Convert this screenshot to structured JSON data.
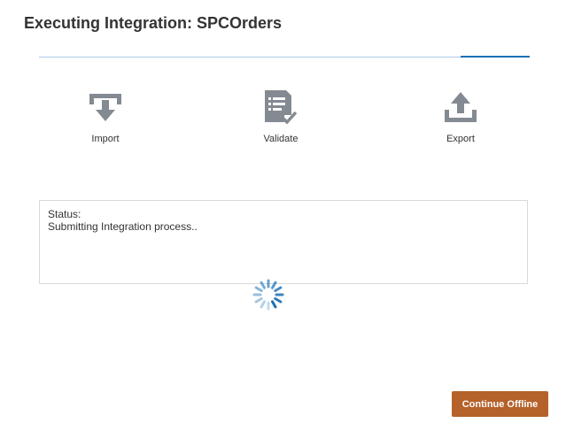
{
  "dialog": {
    "title": "Executing Integration: SPCOrders"
  },
  "progress": {
    "fraction": 0.14,
    "track_color": "#a9cbe6",
    "fill_color": "#1a70b8"
  },
  "steps": [
    {
      "label": "Import",
      "icon": "import-icon"
    },
    {
      "label": "Validate",
      "icon": "validate-icon"
    },
    {
      "label": "Export",
      "icon": "export-icon"
    }
  ],
  "status": {
    "heading": "Status:",
    "message": "Submitting Integration process.."
  },
  "actions": {
    "continue_label": "Continue Offline",
    "accent_color": "#b5612a"
  },
  "icon_color": "#848a91",
  "spinner_color": "#1a70b8"
}
